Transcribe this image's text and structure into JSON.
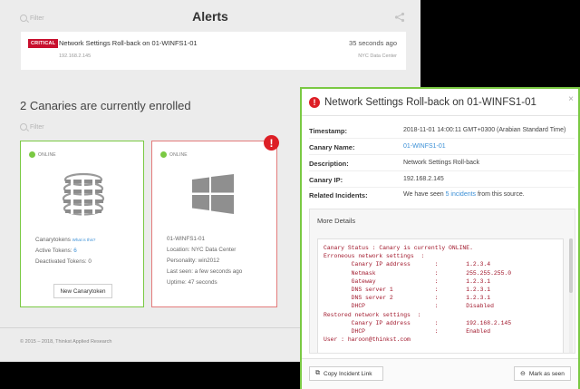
{
  "page": {
    "title": "Alerts",
    "filter_placeholder": "Filter",
    "enrolled_title": "2 Canaries are currently enrolled",
    "footer": "© 2015 – 2018, Thinkst Applied Research"
  },
  "alert": {
    "badge": "CRITICAL",
    "title": "Network Settings Roll-back on 01-WINFS1-01",
    "ip": "192.168.2.145",
    "time_ago": "35 seconds ago",
    "location": "NYC Data Center"
  },
  "canaries": [
    {
      "status": "ONLINE",
      "name": "Canarytokens",
      "what_link": "What is this?",
      "active_label": "Active Tokens:",
      "active_value": "6",
      "deactivated_label": "Deactivated Tokens:",
      "deactivated_value": "0",
      "button": "New Canarytoken"
    },
    {
      "status": "ONLINE",
      "name": "01-WINFS1-01",
      "location": "Location: NYC Data Center",
      "personality": "Personality: win2012",
      "last_seen": "Last seen: a few seconds ago",
      "uptime": "Uptime: 47 seconds",
      "alert_marker": "!"
    }
  ],
  "modal": {
    "title": "Network Settings Roll-back on 01-WINFS1-01",
    "close": "×",
    "rows": {
      "timestamp_label": "Timestamp:",
      "timestamp_value": "2018-11-01 14:00:11 GMT+0300 (Arabian Standard Time)",
      "canary_label": "Canary Name:",
      "canary_value": "01-WINFS1-01",
      "description_label": "Description:",
      "description_value": "Network Settings Roll-back",
      "ip_label": "Canary IP:",
      "ip_value": "192.168.2.145",
      "incidents_label": "Related Incidents:",
      "incidents_prefix": "We have seen ",
      "incidents_link": "5 incidents",
      "incidents_suffix": " from this source."
    },
    "more_details_label": "More Details",
    "log": [
      "Canary Status : Canary is currently ONLINE.",
      "Erroneous network settings  :",
      "        Canary IP address       :        1.2.3.4",
      "        Netmask                 :        255.255.255.0",
      "        Gateway                 :        1.2.3.1",
      "        DNS server 1            :        1.2.3.1",
      "        DNS server 2            :        1.2.3.1",
      "        DHCP                    :        Disabled",
      "Restored network settings  :",
      "        Canary IP address       :        192.168.2.145",
      "        DHCP                    :        Enabled",
      "User : haroon@thinkst.com"
    ],
    "copy_button": "Copy Incident Link",
    "mark_seen_button": "Mark as seen"
  },
  "colors": {
    "online": "#7ac943",
    "critical": "#c8102e",
    "link": "#3a8fd6",
    "log_text": "#a0162a"
  },
  "icons": [
    "search-icon",
    "share-icon",
    "canarytokens-logo-icon",
    "windows-logo-icon",
    "alert-icon",
    "close-icon",
    "copy-link-icon",
    "mark-seen-icon"
  ]
}
